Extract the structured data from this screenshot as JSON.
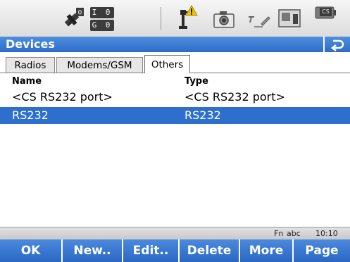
{
  "status": {
    "icons": [
      "satellite-icon",
      "counts-icon",
      "pole-warning-icon",
      "camera-icon",
      "cursor-pen-icon",
      "memory-card-icon",
      "battery-icon"
    ],
    "sat_counts": [
      "I 0",
      "G 0"
    ],
    "battery_label": "CS",
    "warning_color": "#f2c200"
  },
  "titlebar": {
    "title": "Devices",
    "back_icon": "return-arrow-icon"
  },
  "tabs": [
    {
      "label": "Radios",
      "active": false
    },
    {
      "label": "Modems/GSM",
      "active": false
    },
    {
      "label": "Others",
      "active": true
    }
  ],
  "list": {
    "headers": [
      "Name",
      "Type"
    ],
    "rows": [
      {
        "name": "<CS RS232 port>",
        "type": "<CS RS232 port>",
        "selected": false
      },
      {
        "name": "RS232",
        "type": "RS232",
        "selected": true
      }
    ]
  },
  "info": {
    "fn": "Fn",
    "input_mode": "abc",
    "time": "10:10"
  },
  "softkeys": [
    "OK",
    "New..",
    "Edit..",
    "Delete",
    "More",
    "Page"
  ],
  "colors": {
    "accent": "#2e6fce",
    "highlight_text": "#ffffff"
  }
}
